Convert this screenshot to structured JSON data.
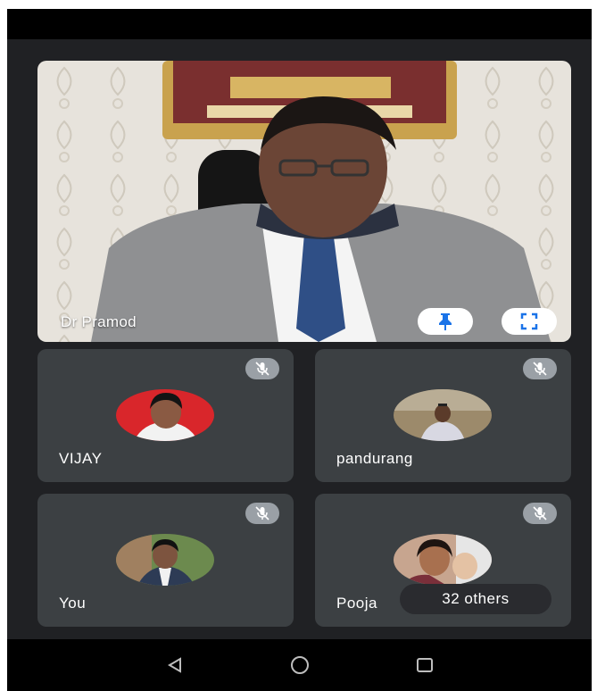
{
  "featured": {
    "name": "Dr Pramod",
    "pin_icon": "pin-icon",
    "fullscreen_icon": "fullscreen-icon"
  },
  "participants": [
    {
      "name": "VIJAY",
      "muted": true
    },
    {
      "name": "pandurang",
      "muted": true
    },
    {
      "name": "You",
      "muted": true
    },
    {
      "name": "Pooja",
      "muted": true
    }
  ],
  "others_label": "32 others",
  "nav": {
    "back_icon": "back-triangle-icon",
    "home_icon": "home-circle-icon",
    "recents_icon": "recents-square-icon"
  },
  "colors": {
    "background": "#202124",
    "tile": "#3c4043",
    "mute_badge": "#9aa0a6"
  }
}
